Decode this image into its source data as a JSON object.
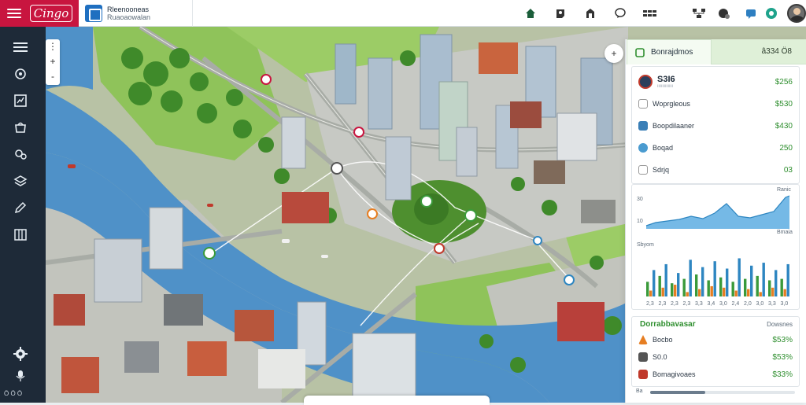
{
  "brand": {
    "logo_text": "Cingo"
  },
  "workspace": {
    "name": "Rleenooneas",
    "sub": "Ruaoaowalan"
  },
  "topbar": {
    "center_icons": [
      "home-icon",
      "share-icon",
      "building-icon",
      "chat-icon",
      "grid-icon"
    ],
    "right_icons": [
      "hierarchy-icon",
      "globe-settings-icon",
      "chat-bubble-icon",
      "status-icon"
    ]
  },
  "sidebar": {
    "items": [
      "menu-icon",
      "dashboard-icon",
      "analytics-icon",
      "shop-icon",
      "settings-icon",
      "layers-icon",
      "pen-icon",
      "building-icon"
    ],
    "footer_text": "Ö Ö Ö"
  },
  "map": {
    "zoom_in": "+",
    "zoom_out": "-"
  },
  "panel": {
    "tab_label": "Bonrajdmos",
    "header_right": "â334 Ö8",
    "balance": {
      "title": "S3I6",
      "subtitle": "ıııııııııııı",
      "value": "$256"
    },
    "rows": [
      {
        "label": "Woprgleous",
        "value": "$530",
        "color": "#ffffff"
      },
      {
        "label": "Boopdilaaner",
        "value": "$430",
        "color": "#3a7fb7"
      },
      {
        "label": "Boqad",
        "value": "250",
        "color": "#4a9bd0"
      },
      {
        "label": "Sdrjq",
        "value": "03",
        "color": "#ffffff"
      }
    ],
    "line_chart": {
      "label_top": "30",
      "label_bottom": "10",
      "tag": "Ranic",
      "tag_bottom": "Bmaia"
    },
    "bar_chart": {
      "label": "Sbyom",
      "categories": [
        "2,3",
        "2,3",
        "2,3",
        "2,3",
        "3,3",
        "3,4",
        "3,0",
        "2,4",
        "2,0",
        "3,0",
        "3,3",
        "3,0"
      ],
      "series": [
        {
          "color": "#3a9a3a",
          "values": [
            10,
            14,
            9,
            12,
            15,
            11,
            13,
            10,
            12,
            14,
            11,
            12
          ]
        },
        {
          "color": "#e67e22",
          "values": [
            4,
            6,
            8,
            3,
            5,
            7,
            6,
            4,
            5,
            3,
            6,
            5
          ]
        },
        {
          "color": "#2e86c1",
          "values": [
            18,
            22,
            16,
            25,
            20,
            24,
            19,
            26,
            21,
            23,
            18,
            22
          ]
        }
      ],
      "ylim": [
        0,
        30
      ]
    },
    "summary": {
      "title": "Dorrabbavasar",
      "right": "Dowsnes",
      "rows": [
        {
          "label": "Bocbo",
          "value": "$53%",
          "color": "#e67e22"
        },
        {
          "label": "S0.0",
          "value": "$53%",
          "color": "#555555"
        },
        {
          "label": "Bomagivoaes",
          "value": "$33%",
          "color": "#c0392b"
        }
      ],
      "progress_label": "Ba",
      "progress": 0.38
    }
  },
  "colors": {
    "water": "#4f91c8",
    "grass": "#8fc35a",
    "road": "#b9bdb9",
    "brand": "#c8153f",
    "sidebar": "#1e2a38"
  }
}
